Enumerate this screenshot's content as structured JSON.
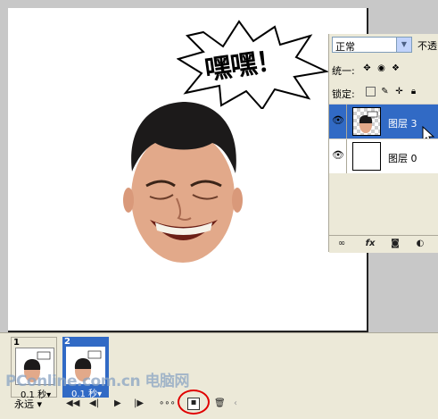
{
  "canvas": {
    "speech_bubble_text": "嘿嘿！"
  },
  "layers_panel": {
    "blend_mode": "正常",
    "opacity_label": "不透",
    "unify_label": "统一:",
    "lock_label": "锁定:",
    "layers": [
      {
        "name": "图层 3",
        "selected": true
      },
      {
        "name": "图层 0",
        "selected": false
      }
    ],
    "bottom_icons": [
      "link-icon",
      "fx-icon",
      "mask-icon",
      "adjustment-icon"
    ]
  },
  "animation_panel": {
    "frames": [
      {
        "number": "1",
        "delay": "0.1 秒▾",
        "selected": false
      },
      {
        "number": "2",
        "delay": "0.1 秒▾",
        "selected": true
      }
    ],
    "loop": "永远",
    "controls": [
      "first-frame-icon",
      "prev-frame-icon",
      "play-icon",
      "next-frame-icon",
      "tween-icon",
      "duplicate-frame-icon",
      "delete-frame-icon"
    ],
    "watermark": "PConline.com.cn 电脑网"
  },
  "colors": {
    "selection": "#316ac5",
    "highlight": "#e00000"
  }
}
